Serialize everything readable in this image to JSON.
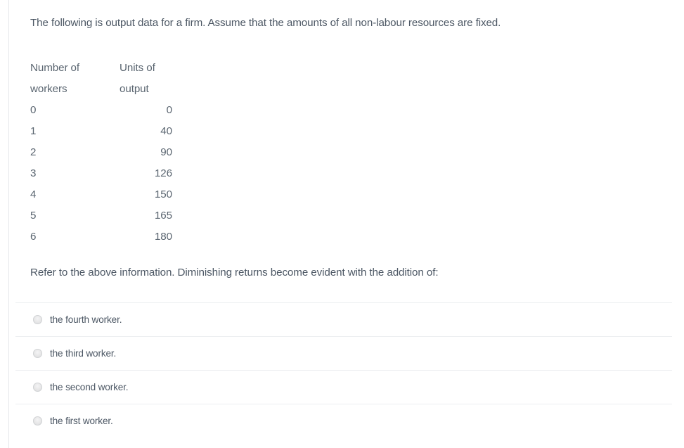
{
  "question": {
    "intro": "The following is output data for a firm. Assume that the amounts of all non-labour resources are fixed.",
    "stem": "Refer to the above information. Diminishing returns become evident with the addition of:"
  },
  "table": {
    "headers": [
      [
        "Number of",
        "Units of"
      ],
      [
        "workers",
        "output"
      ]
    ],
    "header_col1_line1": "Number of",
    "header_col1_line2": "workers",
    "header_col2_line1": "Units of",
    "header_col2_line2": "output",
    "rows": [
      {
        "workers": "0",
        "output": "0"
      },
      {
        "workers": "1",
        "output": "40"
      },
      {
        "workers": "2",
        "output": "90"
      },
      {
        "workers": "3",
        "output": "126"
      },
      {
        "workers": "4",
        "output": "150"
      },
      {
        "workers": "5",
        "output": "165"
      },
      {
        "workers": "6",
        "output": "180"
      }
    ]
  },
  "options": [
    {
      "label": "the fourth worker.",
      "icon": "radio-unselected-icon",
      "selected": false
    },
    {
      "label": "the third worker.",
      "icon": "radio-unselected-icon",
      "selected": false
    },
    {
      "label": "the second worker.",
      "icon": "radio-unselected-icon",
      "selected": false
    },
    {
      "label": "the first worker.",
      "icon": "radio-unselected-icon",
      "selected": false
    }
  ],
  "colors": {
    "text": "#4c5764",
    "table_text": "#5a6570",
    "divider": "#eceef0",
    "left_rule": "#e6e8ea",
    "radio_fill": "#e3e3e4",
    "background": "#ffffff"
  }
}
